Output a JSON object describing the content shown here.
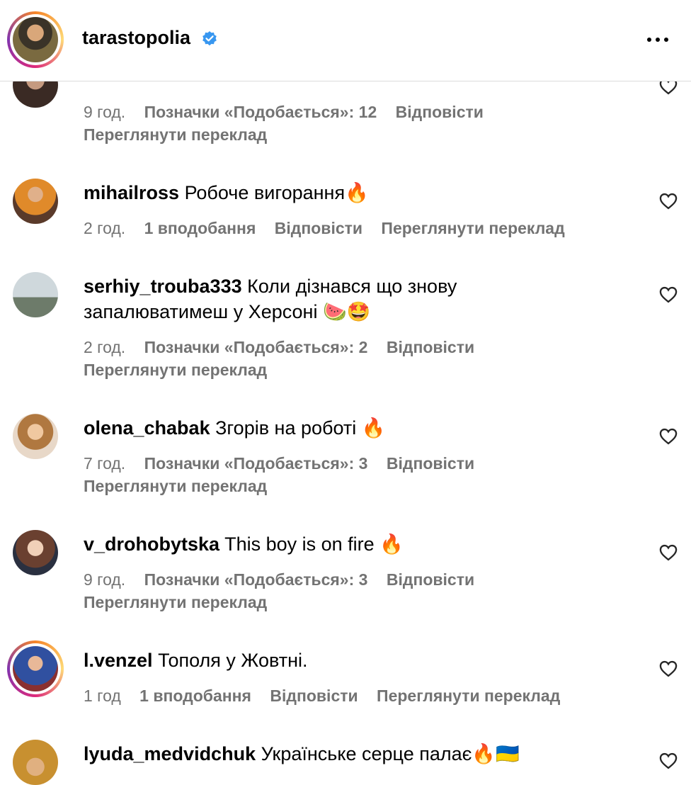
{
  "header": {
    "username": "tarastopolia",
    "verified_color": "#3897f0"
  },
  "comments": [
    {
      "id": "partial-top",
      "time": "9 год.",
      "likes": "Позначки «Подобається»: 12",
      "reply": "Відповісти",
      "translate": "Переглянути переклад"
    },
    {
      "username": "mihailross",
      "text": "Робоче вигорання🔥",
      "time": "2 год.",
      "likes": "1 вподобання",
      "reply": "Відповісти",
      "translate": "Переглянути переклад"
    },
    {
      "username": "serhiy_trouba333",
      "text": "Коли дізнався що знову запалюватимеш у Херсоні 🍉🤩",
      "time": "2 год.",
      "likes": "Позначки «Подобається»: 2",
      "reply": "Відповісти",
      "translate": "Переглянути переклад"
    },
    {
      "username": "olena_chabak",
      "text": "Згорів на роботі 🔥",
      "time": "7 год.",
      "likes": "Позначки «Подобається»: 3",
      "reply": "Відповісти",
      "translate": "Переглянути переклад"
    },
    {
      "username": "v_drohobytska",
      "text": "This boy is on fire 🔥",
      "time": "9 год.",
      "likes": "Позначки «Подобається»: 3",
      "reply": "Відповісти",
      "translate": "Переглянути переклад"
    },
    {
      "username": "l.venzel",
      "text": "Тополя у Жовтні.",
      "time": "1 год",
      "likes": "1 вподобання",
      "reply": "Відповісти",
      "translate": "Переглянути переклад"
    },
    {
      "username": "lyuda_medvidchuk",
      "text": "Українське серце палає🔥🇺🇦"
    }
  ]
}
